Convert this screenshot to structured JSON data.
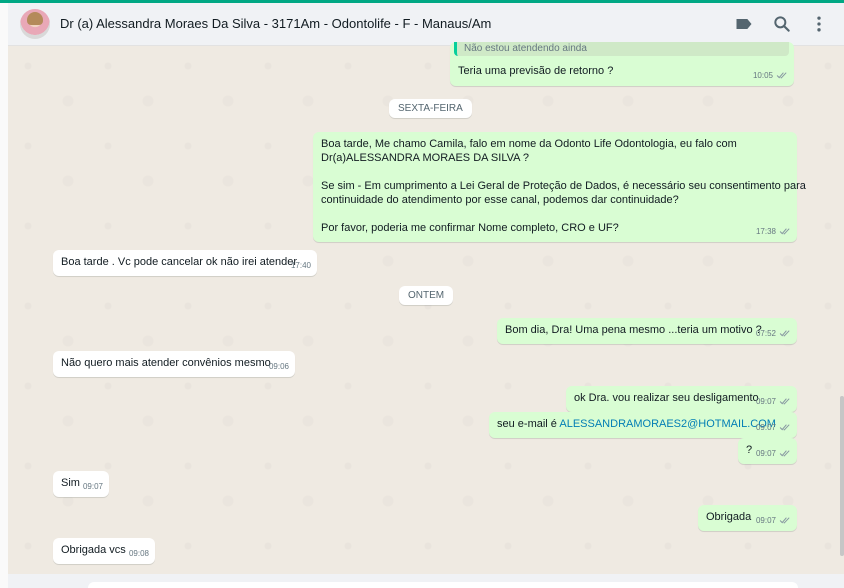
{
  "header": {
    "title": "Dr (a) Alessandra Moraes Da Silva - 3171Am - Odontolife - F - Manaus/Am"
  },
  "colors": {
    "accent": "#00a884",
    "outgoing": "#d9fdd3",
    "incoming": "#ffffff",
    "link": "#027eb5",
    "check": "#8696a0"
  },
  "icons": [
    "label-icon",
    "search-icon",
    "menu-dots-icon",
    "double-check-icon"
  ],
  "messages": {
    "m1": {
      "quote": "Não estou atendendo ainda",
      "text": "Teria uma previsão de retorno ?",
      "time": "10:05"
    },
    "date1": "SEXTA-FEIRA",
    "m2": {
      "line1": "Boa tarde, Me chamo Camila, falo em nome da Odonto Life Odontologia, eu falo com",
      "line2": "Dr(a)ALESSANDRA MORAES DA SILVA ?",
      "line3": "Se sim - Em cumprimento a Lei Geral de Proteção de Dados, é necessário seu consentimento para",
      "line4": "continuidade do atendimento por esse canal, podemos dar continuidade?",
      "line5": "Por favor, poderia me confirmar Nome completo, CRO e UF?",
      "time": "17:38"
    },
    "m3": {
      "text": "Boa tarde . Vc pode cancelar ok não irei atender",
      "time": "17:40"
    },
    "date2": "ONTEM",
    "m4": {
      "text": "Bom dia, Dra! Uma pena mesmo ...teria um motivo ?",
      "time": "07:52"
    },
    "m5": {
      "text": "Não quero mais atender convênios mesmo",
      "time": "09:06"
    },
    "m6": {
      "text": "ok Dra. vou realizar seu desligamento",
      "time": "09:07"
    },
    "m7": {
      "prefix": "seu e-mail é ",
      "email": "ALESSANDRAMORAES2@HOTMAIL.COM",
      "time": "09:07"
    },
    "m8": {
      "text": "?",
      "time": "09:07"
    },
    "m9": {
      "text": "Sim",
      "time": "09:07"
    },
    "m10": {
      "text": "Obrigada",
      "time": "09:07"
    },
    "m11": {
      "text": "Obrigada vcs",
      "time": "09:08"
    }
  }
}
